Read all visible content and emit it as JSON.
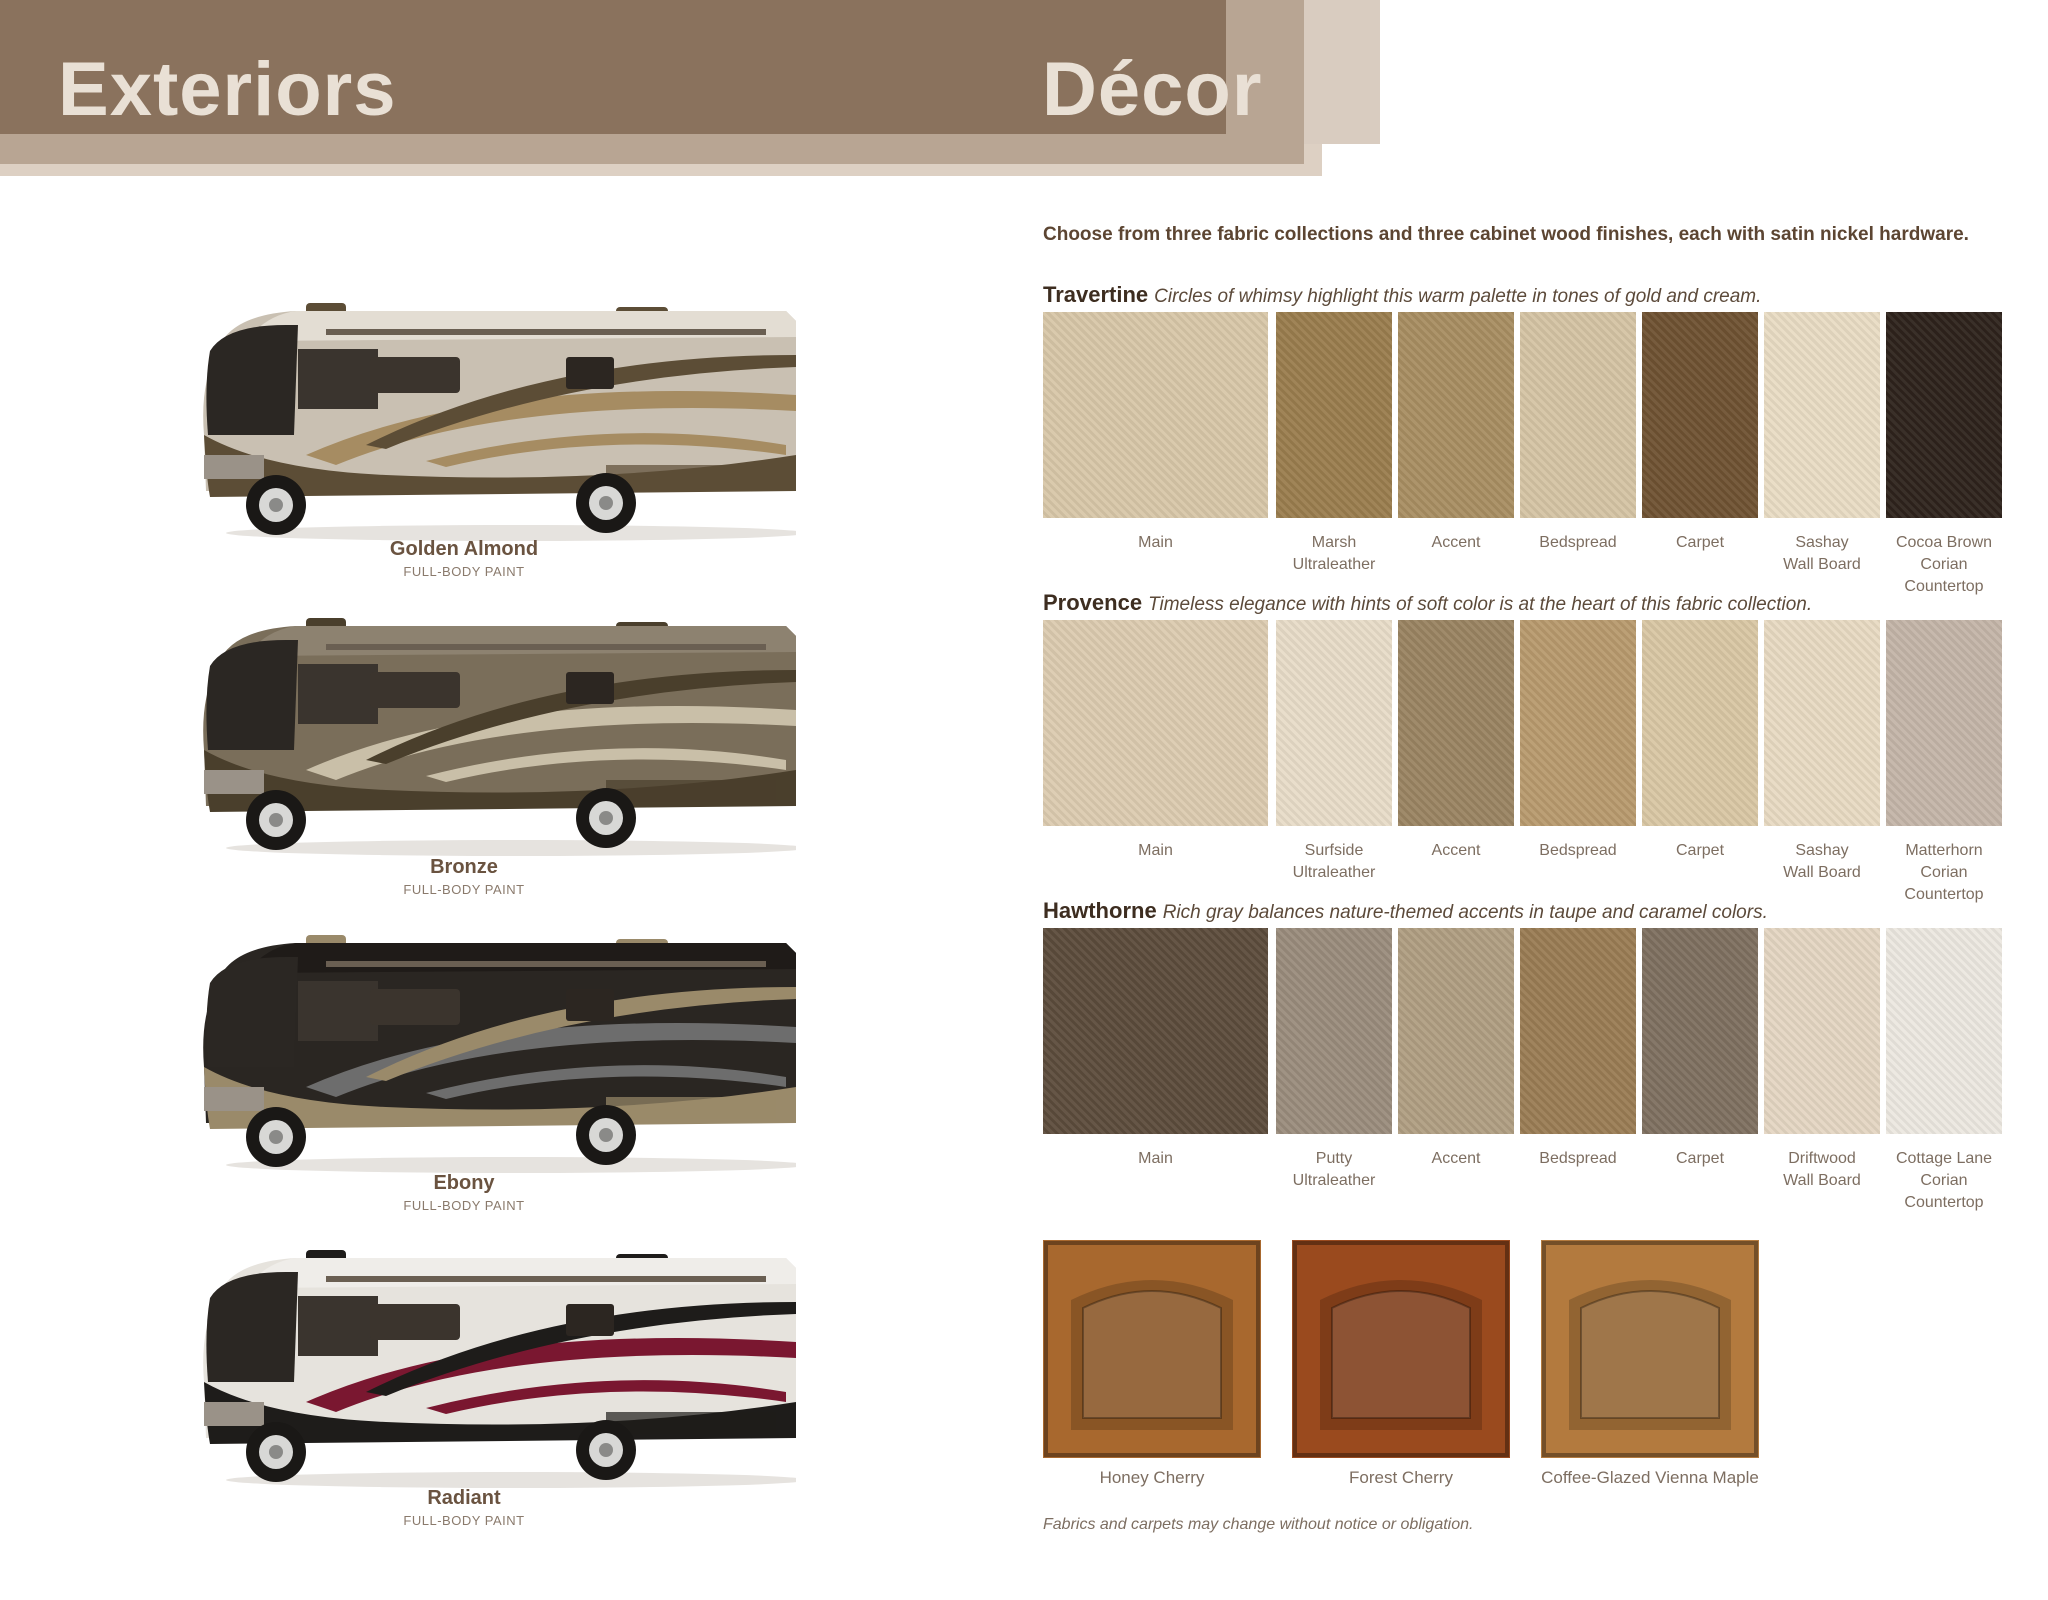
{
  "header": {
    "left_title": "Exteriors",
    "right_title": "Décor"
  },
  "exteriors": [
    {
      "name": "Golden Almond",
      "sub": "FULL-BODY PAINT",
      "body": "#c9c0b2",
      "stripe1": "#5c4d36",
      "stripe2": "#a68c62",
      "roof": "#e3ddd3"
    },
    {
      "name": "Bronze",
      "sub": "FULL-BODY PAINT",
      "body": "#7a6e5a",
      "stripe1": "#4a3f2c",
      "stripe2": "#c9bfa8",
      "roof": "#8d8270"
    },
    {
      "name": "Ebony",
      "sub": "FULL-BODY PAINT",
      "body": "#2a2622",
      "stripe1": "#9a8a6a",
      "stripe2": "#6d6d6d",
      "roof": "#1f1b18"
    },
    {
      "name": "Radiant",
      "sub": "FULL-BODY PAINT",
      "body": "#e6e3dd",
      "stripe1": "#1e1c1a",
      "stripe2": "#7a1730",
      "roof": "#efede9"
    }
  ],
  "decor": {
    "intro": "Choose from three fabric collections and three cabinet wood finishes, each with satin nickel hardware.",
    "collections": [
      {
        "name": "Travertine",
        "desc": "Circles of whimsy highlight this warm palette in tones of gold and cream.",
        "swatches": [
          {
            "label": "Main",
            "color": "#d8c7a8"
          },
          {
            "label": "Marsh\nUltraleather",
            "color": "#9a7d4e"
          },
          {
            "label": "Accent",
            "color": "#a88e62"
          },
          {
            "label": "Bedspread",
            "color": "#d5c4a4"
          },
          {
            "label": "Carpet",
            "color": "#6f5232"
          },
          {
            "label": "Sashay\nWall Board",
            "color": "#e9dcc4"
          },
          {
            "label": "Cocoa Brown\nCorian\nCountertop",
            "color": "#2e231c"
          }
        ]
      },
      {
        "name": "Provence",
        "desc": "Timeless elegance with hints of soft color is at the heart of this fabric collection.",
        "swatches": [
          {
            "label": "Main",
            "color": "#dccbb0"
          },
          {
            "label": "Surfside\nUltraleather",
            "color": "#e8dcc8"
          },
          {
            "label": "Accent",
            "color": "#9a8462"
          },
          {
            "label": "Bedspread",
            "color": "#b89a6e"
          },
          {
            "label": "Carpet",
            "color": "#d9c7a4"
          },
          {
            "label": "Sashay\nWall Board",
            "color": "#e8dac2"
          },
          {
            "label": "Matterhorn\nCorian\nCountertop",
            "color": "#c4b5a8"
          }
        ]
      },
      {
        "name": "Hawthorne",
        "desc": "Rich gray balances nature-themed accents in taupe and caramel colors.",
        "swatches": [
          {
            "label": "Main",
            "color": "#5c4c3c"
          },
          {
            "label": "Putty\nUltraleather",
            "color": "#9a8c7c"
          },
          {
            "label": "Accent",
            "color": "#b09e82"
          },
          {
            "label": "Bedspread",
            "color": "#9a7c54"
          },
          {
            "label": "Carpet",
            "color": "#7e7060"
          },
          {
            "label": "Driftwood\nWall Board",
            "color": "#e4d6c2"
          },
          {
            "label": "Cottage Lane\nCorian\nCountertop",
            "color": "#ece8e0"
          }
        ]
      }
    ],
    "woods": [
      {
        "label": "Honey Cherry",
        "color": "#a8682e"
      },
      {
        "label": "Forest Cherry",
        "color": "#9a4a1e"
      },
      {
        "label": "Coffee-Glazed Vienna Maple",
        "color": "#b37a3e"
      }
    ],
    "footnote": "Fabrics and carpets may change without notice or obligation."
  }
}
